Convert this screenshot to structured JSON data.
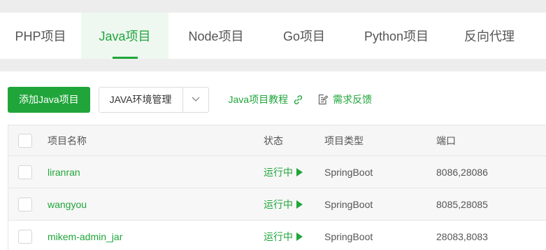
{
  "tabs": [
    {
      "label": "PHP项目",
      "active": false
    },
    {
      "label": "Java项目",
      "active": true
    },
    {
      "label": "Node项目",
      "active": false
    },
    {
      "label": "Go项目",
      "active": false
    },
    {
      "label": "Python项目",
      "active": false
    },
    {
      "label": "反向代理",
      "active": false
    }
  ],
  "toolbar": {
    "add_label": "添加Java项目",
    "env_label": "JAVA环境管理",
    "tutorial_label": "Java项目教程",
    "feedback_label": "需求反馈"
  },
  "table": {
    "headers": {
      "name": "项目名称",
      "status": "状态",
      "type": "项目类型",
      "port": "端口"
    },
    "rows": [
      {
        "name": "liranran",
        "status": "运行中",
        "type": "SpringBoot",
        "port": "8086,28086"
      },
      {
        "name": "wangyou",
        "status": "运行中",
        "type": "SpringBoot",
        "port": "8085,28085"
      },
      {
        "name": "mikem-admin_jar",
        "status": "运行中",
        "type": "SpringBoot",
        "port": "28083,8083"
      }
    ]
  },
  "colors": {
    "accent": "#20a53a",
    "active_tab_bg": "#eef8f1"
  }
}
